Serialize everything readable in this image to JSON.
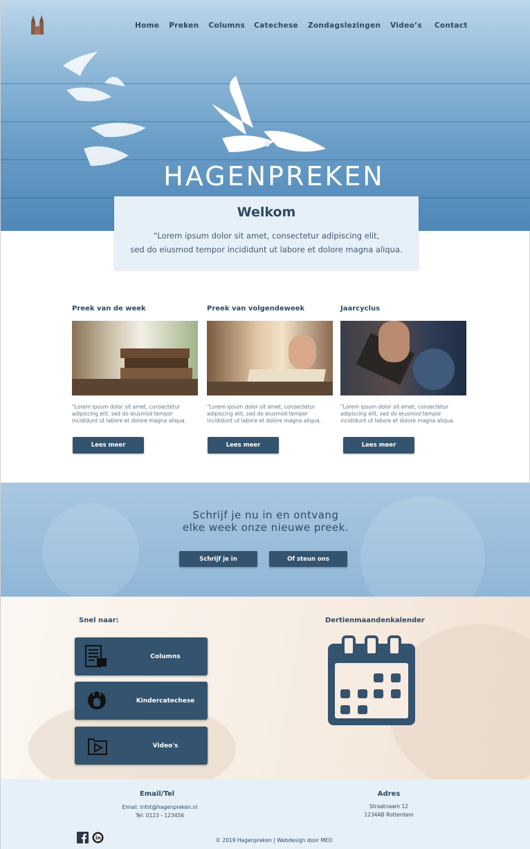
{
  "nav": {
    "items": [
      "Home",
      "Preken",
      "Columns",
      "Catechese",
      "Zondagslezingen",
      "Video’s",
      "Contact"
    ]
  },
  "hero": {
    "title": "HAGENPREKEN"
  },
  "welcome": {
    "title": "Welkom",
    "line1": "“Lorem ipsum dolor sit amet, consectetur adipiscing elit,",
    "line2": "sed do eiusmod tempor incididunt ut labore et dolore magna aliqua."
  },
  "cards": [
    {
      "title": "Preek van de week",
      "text": "“Lorem ipsum dolor sit amet, consectetur adipiscing elit, sed do eiusmod tempor incididunt ut labore et dolore magna aliqua.",
      "button": "Lees meer"
    },
    {
      "title": "Preek van volgendeweek",
      "text": "“Lorem ipsum dolor sit amet, consectetur adipiscing elit, sed do eiusmod tempor incididunt ut labore et dolore magna aliqua.",
      "button": "Lees meer"
    },
    {
      "title": "Jaarcyclus",
      "text": "“Lorem ipsum dolor sit amet, consectetur adipiscing elit, sed do eiusmod tempor incididunt ut labore et dolore magna aliqua.",
      "button": "Lees meer"
    }
  ],
  "newsletter": {
    "line1": "Schrijf je nu in en ontvang",
    "line2": "elke week onze nieuwe preek.",
    "subscribe_button": "Schrijf je in",
    "support_button": "Of steun ons"
  },
  "quick": {
    "heading": "Snel naar:",
    "links": [
      {
        "label": "Columns",
        "icon": "newspaper-icon"
      },
      {
        "label": "Kindercatechese",
        "icon": "child-icon"
      },
      {
        "label": "Video's",
        "icon": "video-icon"
      }
    ],
    "calendar_heading": "Dertienmaandenkalender",
    "calendar_icon": "calendar-icon"
  },
  "footer": {
    "contact_heading": "Email/Tel",
    "email": "Email: infot@hagenpreken.nl",
    "phone": "Tel: 0123 - 123456",
    "address_heading": "Adres",
    "street": "Straatnaam 12",
    "city": "1234AB Rotterdam",
    "copyright": "© 2019 Hagenpreken | Webdesign door MEO"
  },
  "colors": {
    "primary": "#34536e",
    "text": "#2e4a63",
    "light": "#e6f0f8"
  }
}
